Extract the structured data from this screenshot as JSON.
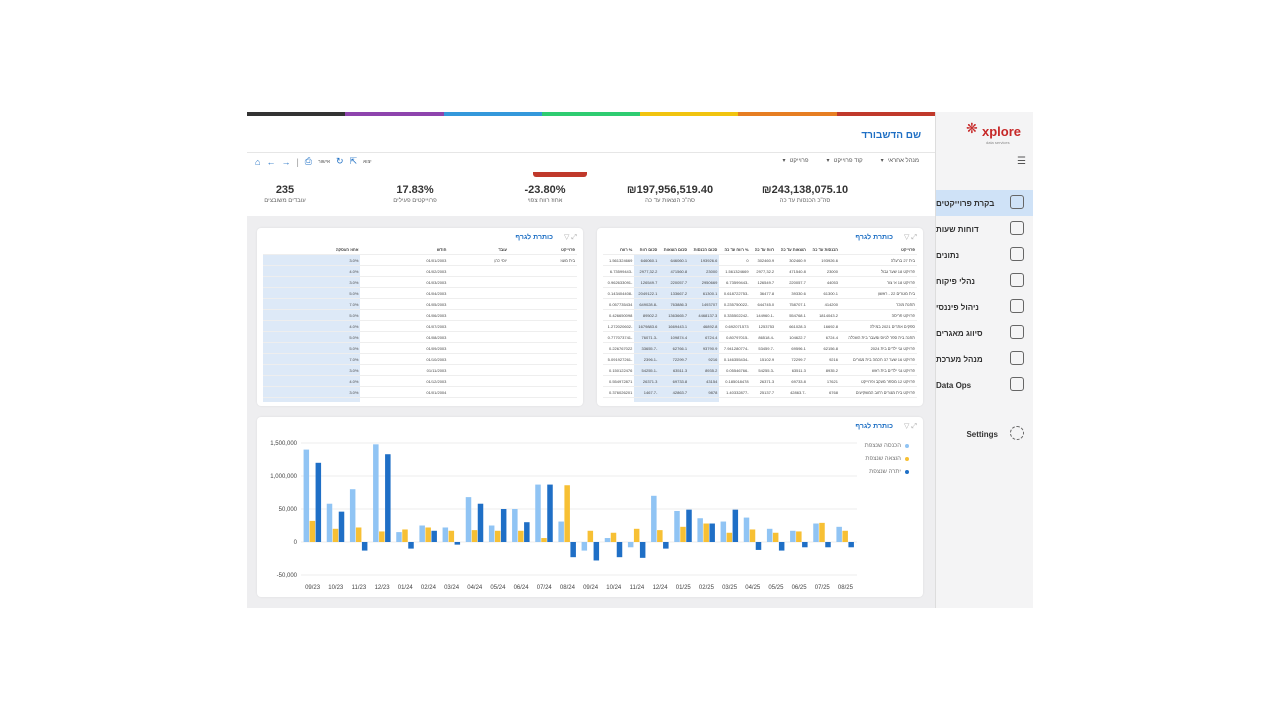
{
  "brand": {
    "logo_text": "xplore",
    "logo_sub": "data services",
    "hamburger": "menu-icon"
  },
  "top_stripe_colors": [
    "#333333",
    "#8e44ad",
    "#3498db",
    "#2ecc71",
    "#f1c40f",
    "#e67e22",
    "#c0392b"
  ],
  "sidebar": {
    "items": [
      {
        "label": "בקרת פרוייקטים",
        "icon": "monitor-icon",
        "active": true
      },
      {
        "label": "דוחות שעות",
        "icon": "stopwatch-icon",
        "active": false
      },
      {
        "label": "נתונים",
        "icon": "magnifier-icon",
        "active": false
      },
      {
        "label": "נהלי פיקוח",
        "icon": "checklist-icon",
        "active": false
      },
      {
        "label": "ניהול פיננסי",
        "icon": "finance-icon",
        "active": false
      },
      {
        "label": "סיווג מאגרים",
        "icon": "shield-icon",
        "active": false
      },
      {
        "label": "מנהל מערכת",
        "icon": "admin-users-icon",
        "active": false
      },
      {
        "label": "Data Ops",
        "icon": "hex-cluster-icon",
        "active": false
      }
    ],
    "settings_label": "Settings"
  },
  "header": {
    "title": "שם הדשבורד",
    "filters": [
      "מנהל אחראי",
      "קוד פרוייקט",
      "פרוייקט"
    ],
    "toolbar": {
      "save_label": "אישור",
      "export_label": "יצוא"
    }
  },
  "kpis": [
    {
      "value": "₪243,138,075.10",
      "label": "סה\"כ הכנסות עד כה"
    },
    {
      "value": "₪197,956,519.40",
      "label": "סה\"כ הוצאות עד כה"
    },
    {
      "value": "-23.80%",
      "label": "אחוז רווח צפוי"
    },
    {
      "value": "17.83%",
      "label": "פרוייקטים פעילים"
    },
    {
      "value": "235",
      "label": "עובדים משובצים"
    }
  ],
  "card_title": "כותרת לגרף",
  "table_right": {
    "headers": [
      "פרוייקט",
      "הכנסות עד כה",
      "הוצאות עד כה",
      "רווח עד כה",
      "% רווח עד כה",
      "סכום הכנסות",
      "סכום הוצאות",
      "סכום רווח",
      "% רווח"
    ],
    "rows": [
      [
        "בית 27 ברעלה",
        "193926.6",
        "302460.9",
        "302460.9",
        "0",
        "193926.6",
        "646060.1",
        "646060.1",
        "1.561324669"
      ],
      [
        "פרויקט 18 שער גבול",
        "23000",
        "471540.8",
        "2977,32.2",
        "1.561324669",
        "23000",
        "471560.8",
        "2977,32.2",
        "-6.73599443"
      ],
      [
        "פרויקט 18 א' צור",
        "44053",
        "220057.7",
        "126549.7",
        "-6.73599443",
        "2950669",
        "220057.7",
        "126549.7",
        "-0.962633091"
      ],
      [
        "בית מגורים 22 - ראשון",
        "61300.1",
        "39330.6",
        "36477.8",
        "-0.618722753",
        "61300.1",
        "133667.2",
        "2049122.1",
        "-0.143404408"
      ],
      [
        "תחנת מוכר",
        "414200",
        "758707.1",
        "644745.0",
        "-0.235750022",
        "1493707",
        "763886.3",
        "-649028.8",
        "0.057735434"
      ],
      [
        "פרויקט פריסה",
        "1814043.2",
        "554768.1",
        "-144960.1",
        "-0.335502242",
        "4468137.3",
        "1363665.7",
        "89502.2",
        "0.426650098"
      ],
      [
        "ספקים אתרים 2021 במילה",
        "16692.8",
        "661028.3",
        "1253753",
        "0.692071573",
        "46892.8",
        "1669443.1",
        "1679883.6",
        "-1.272020602"
      ],
      [
        "תחנה בית ספר לגיוס ומעבר בית השכלה",
        "6724.4",
        "104622.7",
        "-86518.4",
        "-0.80797015",
        "6724.4",
        "109874.4",
        "-76071.3",
        "-0.777073741"
      ],
      [
        "פרויקט גני ילדים בית 2024",
        "62156.8",
        "69596.1",
        "-53459.7",
        "-7.941280774",
        "93790.9",
        "62766.1",
        "-33655.7",
        "0.226767022"
      ],
      [
        "פרויקט 16 שער 37 חכמה בית מגורים",
        "9216",
        "72299.7",
        "15102.9",
        "-0.146355434",
        "9216",
        "72299.7",
        "-2396.1",
        "-5.091927261"
      ],
      [
        "פרויקט גני ילדים בית ראש",
        "8935.2",
        "63511.3",
        "-54255.3",
        "-0.05546766",
        "8935.2",
        "63511.3",
        "-54255.1",
        "0.150122476"
      ],
      [
        "פרויקט 12 מספר מעקב ופרוייקט",
        "17621",
        "69733.8",
        "26371.3",
        "0.185018478",
        "43154",
        "69733.8",
        "26371.3",
        "0.554972871"
      ],
      [
        "פרויקט בית מגורים רחוב המשקיעים",
        "6768",
        "-42863.7",
        "25137.7",
        "-1.40332877",
        "9878",
        "42863.7",
        "-1467.7",
        "0.376026201"
      ],
      [
        "פרויקט 18 בתי ספר רוסופניה",
        "176207.8",
        "33565.5",
        "33565.5",
        "0",
        "176207.8",
        "-3712.3",
        "-3712.3",
        "0.227938550"
      ],
      [
        "פרויקט 1003",
        "38200",
        "30416.6",
        "341137.4",
        "0.663443478",
        "38200",
        "1217303.0",
        "8560.0",
        "1"
      ]
    ]
  },
  "table_left": {
    "headers": [
      "פרוייקט",
      "עובד",
      "חודש",
      "אחוז העסקה"
    ],
    "rows": [
      [
        "בית מעוז",
        "יוסי כהן",
        "01/01/2003",
        "3.0%"
      ],
      [
        "",
        "",
        "01/02/2003",
        "4.0%"
      ],
      [
        "",
        "",
        "01/03/2003",
        "3.0%"
      ],
      [
        "",
        "",
        "01/04/2003",
        "5.0%"
      ],
      [
        "",
        "",
        "01/05/2003",
        "7.0%"
      ],
      [
        "",
        "",
        "01/06/2003",
        "5.0%"
      ],
      [
        "",
        "",
        "01/07/2003",
        "4.0%"
      ],
      [
        "",
        "",
        "01/08/2003",
        "5.0%"
      ],
      [
        "",
        "",
        "01/09/2003",
        "5.0%"
      ],
      [
        "",
        "",
        "01/10/2003",
        "7.0%"
      ],
      [
        "",
        "",
        "01/11/2003",
        "3.0%"
      ],
      [
        "",
        "",
        "01/12/2003",
        "4.0%"
      ],
      [
        "",
        "",
        "01/01/2004",
        "3.0%"
      ],
      [
        "",
        "",
        "01/02/2004",
        "3.0%"
      ],
      [
        "",
        "",
        "01/03/2004",
        "7.0%"
      ]
    ]
  },
  "chart_data": {
    "type": "bar",
    "categories": [
      "09/23",
      "10/23",
      "11/23",
      "12/23",
      "01/24",
      "02/24",
      "03/24",
      "04/24",
      "05/24",
      "06/24",
      "07/24",
      "08/24",
      "09/24",
      "10/24",
      "11/24",
      "12/24",
      "01/25",
      "02/25",
      "03/25",
      "04/25",
      "05/25",
      "06/25",
      "07/25",
      "08/25"
    ],
    "series": [
      {
        "name": "הכנסה שנצפת",
        "color": "#90c4f4",
        "values": [
          1400000,
          580000,
          800000,
          1480000,
          150000,
          250000,
          220000,
          680000,
          250000,
          500000,
          870000,
          310000,
          -130000,
          60000,
          -80000,
          700000,
          470000,
          360000,
          310000,
          370000,
          200000,
          170000,
          280000,
          230000
        ]
      },
      {
        "name": "הוצאה שנצפת",
        "color": "#f7c034",
        "values": [
          320000,
          200000,
          220000,
          160000,
          190000,
          220000,
          170000,
          180000,
          170000,
          170000,
          60000,
          860000,
          170000,
          140000,
          200000,
          180000,
          230000,
          280000,
          140000,
          190000,
          140000,
          160000,
          290000,
          170000
        ]
      },
      {
        "name": "יתרה שנצפת",
        "color": "#1f6fc6",
        "values": [
          1200000,
          460000,
          -130000,
          1330000,
          -100000,
          170000,
          -40000,
          580000,
          500000,
          300000,
          870000,
          -230000,
          -280000,
          -230000,
          -240000,
          -100000,
          490000,
          280000,
          490000,
          -120000,
          -130000,
          -80000,
          -80000,
          -80000
        ]
      }
    ],
    "ylim": [
      -500000,
      1500000
    ],
    "yticks": [
      -500000,
      0,
      500000,
      1000000,
      1500000
    ],
    "ytick_labels": [
      "-50,000",
      "0",
      "50,000",
      "1,000,000",
      "1,500,000"
    ],
    "grid": true,
    "legend_position": "top-right"
  }
}
